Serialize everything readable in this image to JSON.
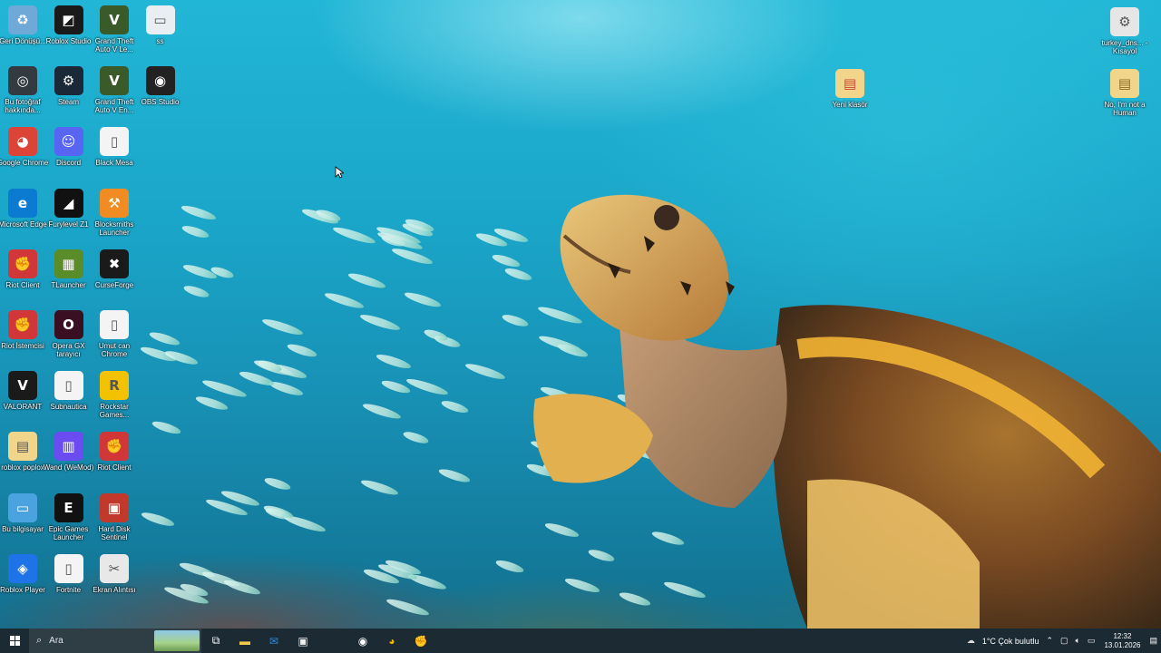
{
  "desktop_icons": [
    {
      "label": "Geri Dönüşü...",
      "icon": "recycle-bin-icon",
      "color": "#6fa9d8",
      "glyph": "♻",
      "x": 0,
      "y": 0
    },
    {
      "label": "Roblox Studio",
      "icon": "roblox-studio-icon",
      "color": "#1a1a1a",
      "glyph": "◩",
      "x": 1,
      "y": 0
    },
    {
      "label": "Grand Theft Auto V Le...",
      "icon": "gta-v-icon",
      "color": "#3a5a2a",
      "glyph": "V",
      "x": 2,
      "y": 0
    },
    {
      "label": "ss",
      "icon": "image-file-icon",
      "color": "#e9eef2",
      "glyph": "▭",
      "x": 3,
      "y": 0
    },
    {
      "label": "Bu fotoğraf hakkında...",
      "icon": "camera-icon",
      "color": "#333a40",
      "glyph": "◎",
      "x": 0,
      "y": 1
    },
    {
      "label": "Steam",
      "icon": "steam-icon",
      "color": "#1b2838",
      "glyph": "⚙",
      "x": 1,
      "y": 1
    },
    {
      "label": "Grand Theft Auto V En...",
      "icon": "gta-v-icon",
      "color": "#3a5a2a",
      "glyph": "V",
      "x": 2,
      "y": 1
    },
    {
      "label": "OBS Studio",
      "icon": "obs-icon",
      "color": "#222222",
      "glyph": "◉",
      "x": 3,
      "y": 1
    },
    {
      "label": "Google Chrome",
      "icon": "chrome-icon",
      "color": "#db4437",
      "glyph": "◕",
      "x": 0,
      "y": 2
    },
    {
      "label": "Discord",
      "icon": "discord-icon",
      "color": "#5865f2",
      "glyph": "☺",
      "x": 1,
      "y": 2
    },
    {
      "label": "Black Mesa",
      "icon": "file-icon",
      "color": "#f4f4f4",
      "glyph": "▯",
      "x": 2,
      "y": 2
    },
    {
      "label": "Microsoft Edge",
      "icon": "edge-icon",
      "color": "#0b7ad1",
      "glyph": "e",
      "x": 0,
      "y": 3
    },
    {
      "label": "Furylevel Z1",
      "icon": "furylevel-icon",
      "color": "#111111",
      "glyph": "◢",
      "x": 1,
      "y": 3
    },
    {
      "label": "Blocksmiths Launcher",
      "icon": "hammer-icon",
      "color": "#f08c22",
      "glyph": "⚒",
      "x": 2,
      "y": 3
    },
    {
      "label": "Riot Client",
      "icon": "riot-client-icon",
      "color": "#d13639",
      "glyph": "✊",
      "x": 0,
      "y": 4
    },
    {
      "label": "TLauncher",
      "icon": "minecraft-block-icon",
      "color": "#5b8c2a",
      "glyph": "▦",
      "x": 1,
      "y": 4
    },
    {
      "label": "CurseForge",
      "icon": "curseforge-icon",
      "color": "#1a1a1a",
      "glyph": "✖",
      "x": 2,
      "y": 4
    },
    {
      "label": "Riot İstemcisi",
      "icon": "riot-client-icon",
      "color": "#d13639",
      "glyph": "✊",
      "x": 0,
      "y": 5
    },
    {
      "label": "Opera GX tarayıcı",
      "icon": "opera-gx-icon",
      "color": "#3a0f22",
      "glyph": "O",
      "x": 1,
      "y": 5
    },
    {
      "label": "Umut can Chrome",
      "icon": "file-icon",
      "color": "#f4f4f4",
      "glyph": "▯",
      "x": 2,
      "y": 5
    },
    {
      "label": "VALORANT",
      "icon": "valorant-icon",
      "color": "#1a1a1a",
      "glyph": "V",
      "x": 0,
      "y": 6
    },
    {
      "label": "Subnautica",
      "icon": "file-icon",
      "color": "#f4f4f4",
      "glyph": "▯",
      "x": 1,
      "y": 6
    },
    {
      "label": "Rockstar Games...",
      "icon": "rockstar-icon",
      "color": "#f2c200",
      "glyph": "R",
      "x": 2,
      "y": 6
    },
    {
      "label": "roblox poplox",
      "icon": "folder-zip-icon",
      "color": "#f1d58a",
      "glyph": "▤",
      "x": 0,
      "y": 7
    },
    {
      "label": "Wand (WeMod)",
      "icon": "wand-icon",
      "color": "#6a4cf0",
      "glyph": "▥",
      "x": 1,
      "y": 7
    },
    {
      "label": "Riot Client",
      "icon": "riot-client-icon",
      "color": "#d13639",
      "glyph": "✊",
      "x": 2,
      "y": 7
    },
    {
      "label": "Bu bilgisayar",
      "icon": "computer-icon",
      "color": "#4aa3df",
      "glyph": "▭",
      "x": 0,
      "y": 8
    },
    {
      "label": "Epic Games Launcher",
      "icon": "epic-games-icon",
      "color": "#111111",
      "glyph": "E",
      "x": 1,
      "y": 8
    },
    {
      "label": "Hard Disk Sentinel",
      "icon": "hard-disk-icon",
      "color": "#c0392b",
      "glyph": "▣",
      "x": 2,
      "y": 8
    },
    {
      "label": "Roblox Player",
      "icon": "roblox-player-icon",
      "color": "#1e73e8",
      "glyph": "◈",
      "x": 0,
      "y": 9
    },
    {
      "label": "Fortnite",
      "icon": "file-icon",
      "color": "#f4f4f4",
      "glyph": "▯",
      "x": 1,
      "y": 9
    },
    {
      "label": "Ekran Alıntısı",
      "icon": "snipping-tool-icon",
      "color": "#e8e8e8",
      "glyph": "✂",
      "x": 2,
      "y": 9
    }
  ],
  "right_icons": [
    {
      "label": "Yeni klasör",
      "icon": "folder-icon",
      "color": "#f1d58a",
      "glyph": "▤"
    },
    {
      "label": "turkey_dns... - Kısayol",
      "icon": "shortcut-icon",
      "color": "#e6e6e6",
      "glyph": "⚙"
    },
    {
      "label": "No, I'm not a Human",
      "icon": "folder-zip-icon",
      "color": "#f1d58a",
      "glyph": "▤"
    }
  ],
  "taskbar": {
    "search_placeholder": "Ara",
    "weather_text": "1°C  Çok bulutlu",
    "time": "12:32",
    "date": "13.01.2026",
    "background": "#1c2a33"
  }
}
